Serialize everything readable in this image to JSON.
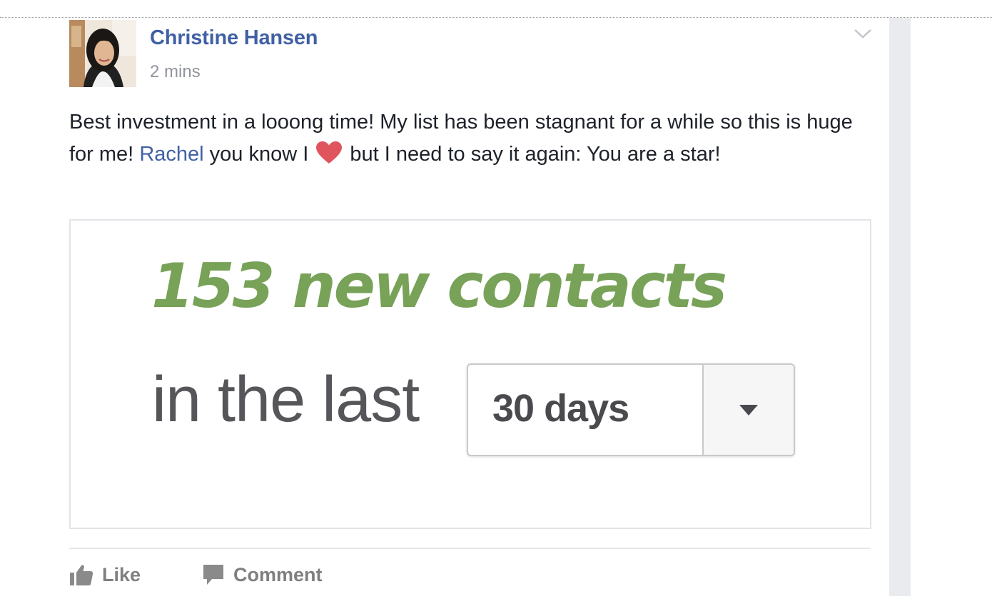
{
  "post": {
    "author_name": "Christine Hansen",
    "timestamp": "2 mins",
    "text_part1": "Best investment in a looong time! My list has been stagnant for a while so this is huge for me! ",
    "mention": "Rachel",
    "text_part2": " you know I ",
    "text_part3": " but I need to say it again: You are a star!"
  },
  "attachment": {
    "headline": "153 new contacts",
    "prefix": "in the last",
    "period_selected": "30 days"
  },
  "actions": {
    "like_label": "Like",
    "comment_label": "Comment"
  },
  "icons": {
    "heart": "heart-icon",
    "like": "thumbs-up-icon",
    "comment": "speech-bubble-icon",
    "menu": "chevron-down-icon",
    "dropdown": "triangle-down-icon"
  },
  "colors": {
    "author_link": "#4160a4",
    "headline_green": "#77a258",
    "heart_red": "#e0545e",
    "action_gray": "#7f7f7f"
  }
}
